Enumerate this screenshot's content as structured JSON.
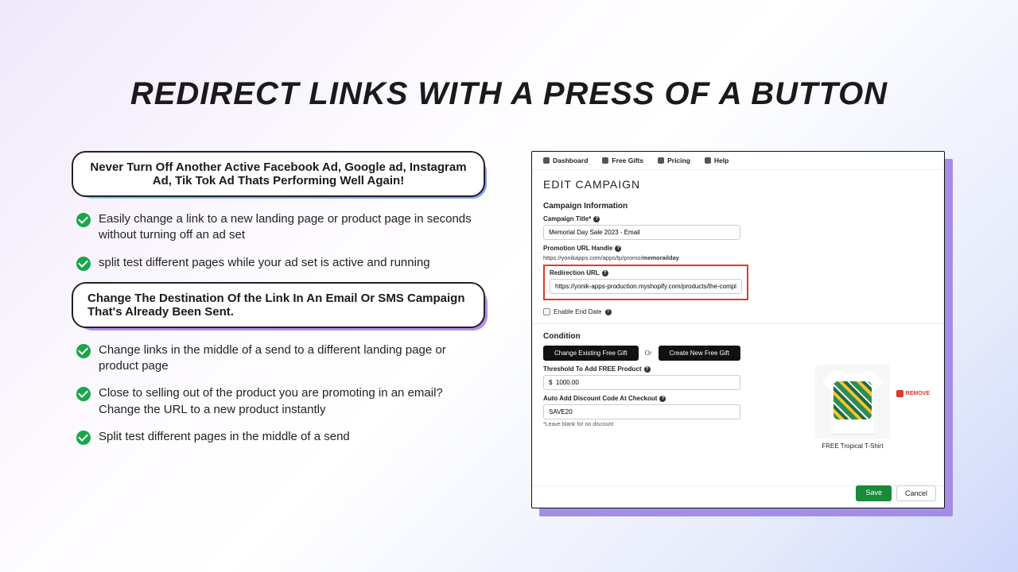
{
  "headline": "REDIRECT LINKS WITH A PRESS OF A BUTTON",
  "callout1": "Never Turn Off Another Active Facebook Ad, Google ad, Instagram Ad, Tik Tok Ad Thats Performing Well Again!",
  "bullets_a": [
    "Easily change a link to a new landing page or product page in seconds without turning off an ad set",
    "split test different pages while your ad set is active and running"
  ],
  "callout2": "Change The Destination Of the Link In An Email Or SMS Campaign That's Already Been Sent.",
  "bullets_b": [
    "Change links in the middle of a send to a different landing page or product page",
    "Close to selling out of the product you are promoting in an email? Change the URL to a new product instantly",
    "Split test different pages in the middle of a send"
  ],
  "app": {
    "nav": {
      "dashboard": "Dashboard",
      "freegifts": "Free Gifts",
      "pricing": "Pricing",
      "help": "Help"
    },
    "title": "EDIT CAMPAIGN",
    "section1": "Campaign Information",
    "campaign_title_label": "Campaign Title*",
    "campaign_title_value": "Memorial Day Sale 2023 - Email",
    "promo_handle_label": "Promotion URL Handle",
    "promo_url_prefix": "https://yonikapps.com/apps/tp/promo/",
    "promo_url_slug": "memorailday",
    "redirect_label": "Redirection URL",
    "redirect_value": "https://yonik-apps-production.myshopify.com/products/the-complete-snowboard",
    "enable_end_date": "Enable End Date",
    "section2": "Condition",
    "btn_change": "Change Existing Free Gift",
    "or": "Or",
    "btn_create": "Create New Free Gift",
    "threshold_label": "Threshold To Add FREE Product",
    "threshold_value": "$  1000.00",
    "discount_label": "Auto Add Discount Code At Checkout",
    "discount_value": "SAVE20",
    "discount_hint": "*Leave blank for no discount",
    "product_caption": "FREE Tropical T-Shirt",
    "remove": "REMOVE",
    "save": "Save",
    "cancel": "Cancel"
  }
}
